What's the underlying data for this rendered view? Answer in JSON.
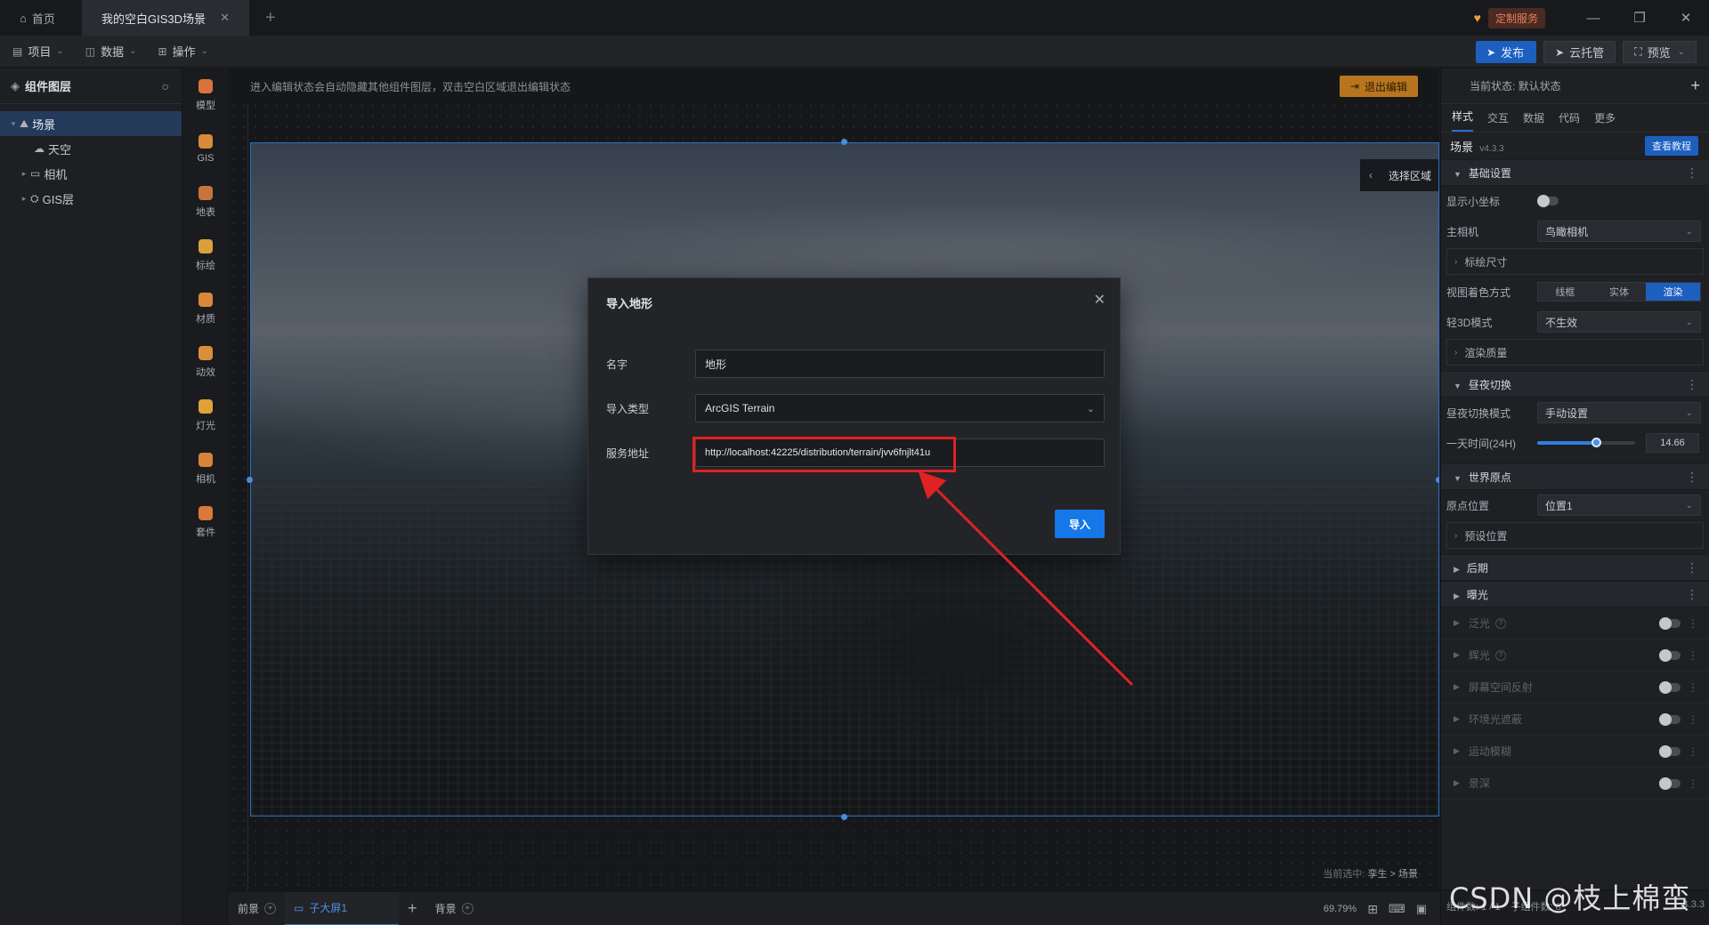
{
  "titlebar": {
    "home_tab": "首页",
    "project_tab": "我的空白GIS3D场景",
    "service_badge": "定制服务"
  },
  "toolbar": {
    "project": "项目",
    "data": "数据",
    "operation": "操作",
    "publish": "发布",
    "cloud_hosting": "云托管",
    "preview": "预览"
  },
  "layers": {
    "title": "组件图层",
    "items": [
      {
        "label": "场景",
        "selected": true
      },
      {
        "label": "天空",
        "selected": false
      },
      {
        "label": "相机",
        "selected": false
      },
      {
        "label": "GIS层",
        "selected": false
      }
    ]
  },
  "components": [
    {
      "label": "模型",
      "color": "#d9733a"
    },
    {
      "label": "GIS",
      "color": "#d98a3a"
    },
    {
      "label": "地表",
      "color": "#c7743d"
    },
    {
      "label": "标绘",
      "color": "#d9a03a"
    },
    {
      "label": "材质",
      "color": "#d9883a"
    },
    {
      "label": "动效",
      "color": "#d98e3a"
    },
    {
      "label": "灯光",
      "color": "#e0a03a"
    },
    {
      "label": "相机",
      "color": "#d9833a"
    },
    {
      "label": "套件",
      "color": "#d97a3a"
    }
  ],
  "stage": {
    "hint": "进入编辑状态会自动隐藏其他组件图层，双击空白区域退出编辑状态",
    "exit_edit": "退出编辑",
    "select_area": "选择区域",
    "current_selection_prefix": "当前选中:",
    "current_selection_path": "孪生 > 场景"
  },
  "modal": {
    "title": "导入地形",
    "name_label": "名字",
    "name_value": "地形",
    "type_label": "导入类型",
    "type_value": "ArcGIS Terrain",
    "url_label": "服务地址",
    "url_value": "http://localhost:42225/distribution/terrain/jvv6fnjlt41u",
    "import_button": "导入"
  },
  "bottombar": {
    "foreground": "前景",
    "sub_screen": "子大屏1",
    "background": "背景",
    "zoom": "69.79%"
  },
  "props": {
    "current_state": "当前状态:  默认状态",
    "tabs": [
      "样式",
      "交互",
      "数据",
      "代码",
      "更多"
    ],
    "active_tab": 0,
    "component_name": "场景",
    "version": "v4.3.3",
    "tutorial": "查看教程",
    "basic": {
      "title": "基础设置",
      "show_axis": "显示小坐标",
      "main_camera": "主相机",
      "main_camera_value": "鸟瞰相机",
      "plot_size": "标绘尺寸",
      "view_color": "视图着色方式",
      "view_color_options": [
        "线框",
        "实体",
        "渲染"
      ],
      "view_color_active": 2,
      "light3d": "轻3D模式",
      "light3d_value": "不生效",
      "render_quality": "渲染质量"
    },
    "daynight": {
      "title": "昼夜切换",
      "mode_label": "昼夜切换模式",
      "mode_value": "手动设置",
      "time_label": "一天时间(24H)",
      "time_value": "14.66",
      "time_fraction": 0.61
    },
    "origin": {
      "title": "世界原点",
      "pos_label": "原点位置",
      "pos_value": "位置1",
      "preset": "预设位置"
    },
    "post": "后期",
    "exposure": "曝光",
    "post_items": [
      "泛光",
      "辉光",
      "屏幕空间反射",
      "环境光遮蔽",
      "运动模糊",
      "景深"
    ],
    "footer": {
      "components": "组件数: 1 / 1",
      "sub_components": "子组件数: 8",
      "version": "4.3.3"
    }
  },
  "watermark": "CSDN @枝上棉蛮"
}
